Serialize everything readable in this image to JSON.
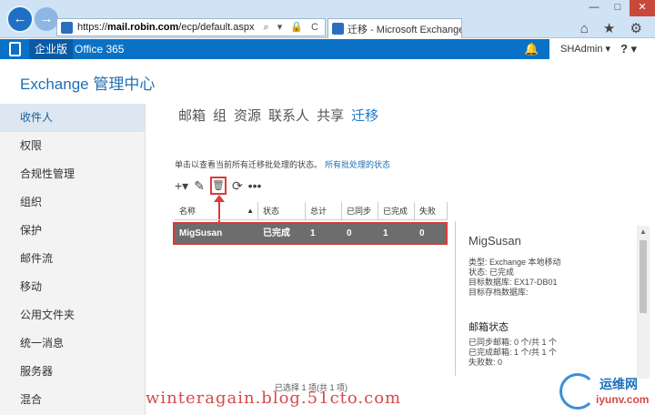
{
  "browser": {
    "url_prefix": "https://",
    "url_domain": "mail.robin.com",
    "url_path": "/ecp/default.aspx",
    "address_tools": "⌕ ▾ 🔒 C",
    "tab_title": "迁移 - Microsoft Exchange",
    "tab_close": "×",
    "window_min": "—",
    "window_max": "□",
    "window_close": "✕",
    "right_icons": "⌂ ★ ⚙"
  },
  "officebar": {
    "active_tab": "企业版",
    "office365": "Office 365",
    "bell": "🔔",
    "user": "SHAdmin ▾",
    "help": "? ▾"
  },
  "app": {
    "title": "Exchange 管理中心"
  },
  "sidebar": {
    "items": [
      {
        "label": "收件人"
      },
      {
        "label": "权限"
      },
      {
        "label": "合规性管理"
      },
      {
        "label": "组织"
      },
      {
        "label": "保护"
      },
      {
        "label": "邮件流"
      },
      {
        "label": "移动"
      },
      {
        "label": "公用文件夹"
      },
      {
        "label": "统一消息"
      },
      {
        "label": "服务器"
      },
      {
        "label": "混合"
      }
    ]
  },
  "topnav": {
    "items": [
      "邮箱",
      "组",
      "资源",
      "联系人",
      "共享",
      "迁移"
    ],
    "active": "迁移"
  },
  "info": {
    "text": "单击以查看当前所有迁移批处理的状态。",
    "link": "所有批处理的状态"
  },
  "toolbar": {
    "add": "+▾",
    "edit": "✎",
    "delete": "🗑",
    "refresh": "⟳",
    "more": "•••"
  },
  "table": {
    "columns": [
      "名称",
      "状态",
      "总计",
      "已同步",
      "已完成",
      "失败"
    ],
    "sort_indicator": "▲",
    "rows": [
      {
        "name": "MigSusan",
        "status": "已完成",
        "total": "1",
        "synced": "0",
        "completed": "1",
        "failed": "0"
      }
    ]
  },
  "status_text": "已选择 1 项(共 1 项)",
  "details": {
    "name": "MigSusan",
    "props": [
      "类型: Exchange 本地移动",
      "状态: 已完成",
      "目标数据库: EX17-DB01",
      "目标存档数据库:"
    ],
    "section": "邮箱状态",
    "stats": [
      "已同步邮箱: 0 个/共 1 个",
      "已完成邮箱: 1 个/共 1 个",
      "失败数: 0"
    ]
  },
  "watermark": {
    "text": "winteragain.blog.51cto.com",
    "logo_cn": "运维网",
    "logo_en": "iyunv.com"
  },
  "colors": {
    "accent": "#0a72c6",
    "highlight": "#d83b3b",
    "selected_row": "#6d6d6d"
  }
}
